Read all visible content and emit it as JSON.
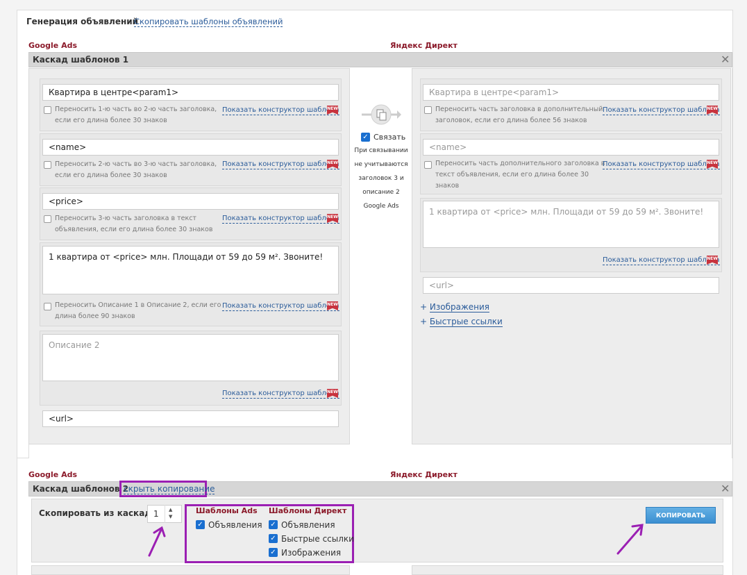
{
  "header": {
    "title": "Генерация объявлений",
    "copy_templates_link": "Скопировать шаблоны объявлений"
  },
  "columns": {
    "google": "Google Ads",
    "yandex": "Яндекс Директ"
  },
  "cascade1": {
    "title": "Каскад шаблонов 1",
    "google": {
      "headline1": "Квартира в центре<param1>",
      "headline1_hint": [
        "Переносить 1-ю часть во 2-ю часть заголовка,",
        "если его длина более 30 знаков"
      ],
      "headline2": "<name>",
      "headline2_hint": [
        "Переносить 2-ю часть во 3-ю часть заголовка,",
        "если его длина более 30 знаков"
      ],
      "headline3": "<price>",
      "headline3_hint": [
        "Переносить 3-ю часть заголовка в текст",
        "объявления, если его длина более 30 знаков"
      ],
      "description1": "1 квартира от <price> млн. Площади от 59 до 59 м². Звоните!",
      "description1_hint": [
        "Переносить Описание 1 в Описание 2, если его",
        "длина более 90 знаков"
      ],
      "description2_placeholder": "Описание 2",
      "url": "<url>"
    },
    "middle": {
      "link_label": "Связать",
      "link_checked": true,
      "note": [
        "При связывании",
        "не учитываются",
        "заголовок 3 и",
        "описание 2",
        "Google Ads"
      ]
    },
    "yandex": {
      "headline": "Квартира в центре<param1>",
      "headline_hint": [
        "Переносить часть заголовка в дополнительный",
        "заголовок, если его длина более 56 знаков"
      ],
      "extra_headline": "<name>",
      "extra_headline_hint": [
        "Переносить часть дополнительного заголовка в",
        "текст объявления, если его длина более 30",
        "знаков"
      ],
      "text": "1 квартира от <price> млн. Площади от 59 до 59 м². Звоните!",
      "url": "<url>",
      "images_link": "Изображения",
      "quicklinks_link": "Быстрые ссылки"
    },
    "builder_link": "Показать конструктор шаблона",
    "new_badge": "NEW"
  },
  "cascade2": {
    "title": "Каскад шаблонов 2",
    "hide_copy_link": "скрыть копирование",
    "copy_from_label": "Скопировать из каскада",
    "copy_from_value": "1",
    "ads_templates_title": "Шаблоны Ads",
    "ads_ads": "Объявления",
    "direct_templates_title": "Шаблоны Директ",
    "direct_ads": "Объявления",
    "direct_quicklinks": "Быстрые ссылки",
    "direct_images": "Изображения",
    "copy_button": "КОПИРОВАТЬ"
  },
  "colors": {
    "accent_link": "#2b5c9a",
    "column_label": "#8b1a2a",
    "highlight": "#9b1fb3",
    "checkbox": "#1a6fd0"
  }
}
